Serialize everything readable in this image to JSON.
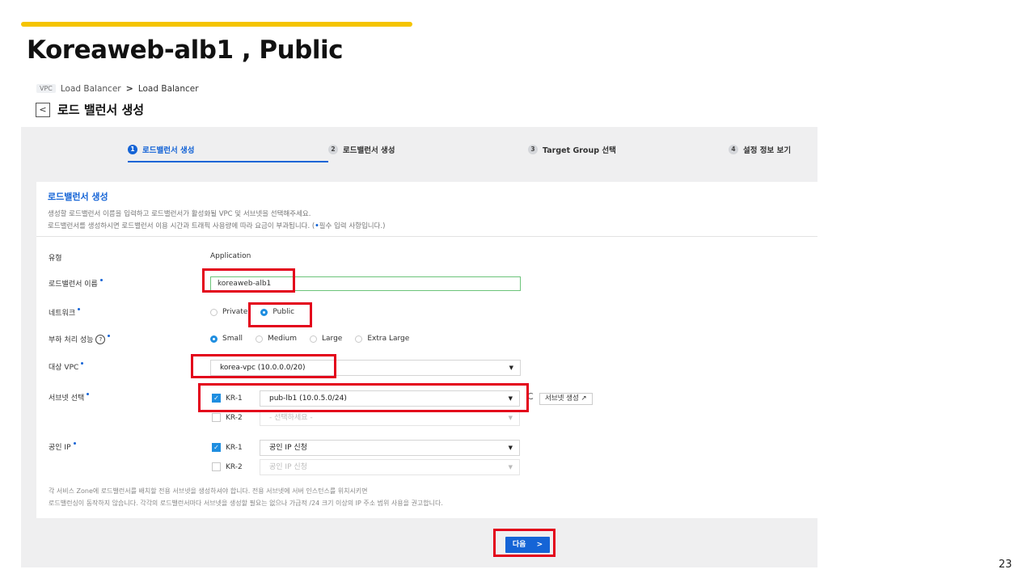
{
  "slide": {
    "title": "Koreaweb-alb1 , Public",
    "page_number": "23",
    "accent_color": "#f5c400",
    "highlight_color": "#e3001b"
  },
  "breadcrumb": {
    "badge": "VPC",
    "parent": "Load Balancer",
    "separator": ">",
    "current": "Load Balancer"
  },
  "header": {
    "back_icon": "chevron-left-icon",
    "back_glyph": "<",
    "page_title": "로드 밸런서 생성"
  },
  "steps": [
    {
      "num": "1",
      "label": "로드밸런서 생성",
      "active": true
    },
    {
      "num": "2",
      "label": "로드밸런서 생성",
      "active": false
    },
    {
      "num": "3",
      "label": "Target Group 선택",
      "active": false
    },
    {
      "num": "4",
      "label": "설정 정보 보기",
      "active": false
    }
  ],
  "card": {
    "title": "로드밸런서 생성",
    "desc_line1": "생성할 로드밸런서 이름을 입력하고 로드밸런서가 활성화될 VPC 및 서브넷을 선택해주세요.",
    "desc_line2_prefix": "로드밸런서를 생성하시면 로드밸런서 이용 시간과 트래픽 사용량에 따라 요금이 부과됩니다. (",
    "desc_line2_dot": "•",
    "desc_line2_suffix": "필수 입력 사항입니다.)"
  },
  "form": {
    "type_label": "유형",
    "type_value": "Application",
    "name_label": "로드밸런서 이름",
    "name_value": "koreaweb-alb1",
    "network_label": "네트워크",
    "network_options": [
      "Private",
      "Public"
    ],
    "network_selected": "Public",
    "perf_label": "부하 처리 성능",
    "help_glyph": "?",
    "perf_options": [
      "Small",
      "Medium",
      "Large",
      "Extra Large"
    ],
    "perf_selected": "Small",
    "vpc_label": "대상 VPC",
    "vpc_value": "korea-vpc (10.0.0.0/20)",
    "subnet_label": "서브넷 선택",
    "subnet_rows": [
      {
        "zone": "KR-1",
        "checked": true,
        "value": "pub-lb1 (10.0.5.0/24)"
      },
      {
        "zone": "KR-2",
        "checked": false,
        "value": "- 선택하세요 -"
      }
    ],
    "refresh_glyph": "C",
    "subnet_create_label": "서브넷 생성",
    "external_link_glyph": "↗",
    "public_ip_label": "공인 IP",
    "public_ip_rows": [
      {
        "zone": "KR-1",
        "checked": true,
        "value": "공인 IP 신청"
      },
      {
        "zone": "KR-2",
        "checked": false,
        "value": "공인 IP 신청"
      }
    ],
    "footnote_line1": "각 서비스 Zone에 로드밸런서를 배치할 전용 서브넷을 생성하셔야 합니다. 전용 서브넷에 서버 인스턴스를 위치시키면",
    "footnote_line2": "로드밸런싱이 동작하지 않습니다. 각각의 로드밸런서마다 서브넷을 생성할 필요는 없으나 가급적 /24 크기 이상의 IP 주소 범위 사용을 권고합니다."
  },
  "footer": {
    "next_label": "다음",
    "next_icon_glyph": ">"
  },
  "glyphs": {
    "caret": "▼",
    "check": "✓"
  }
}
